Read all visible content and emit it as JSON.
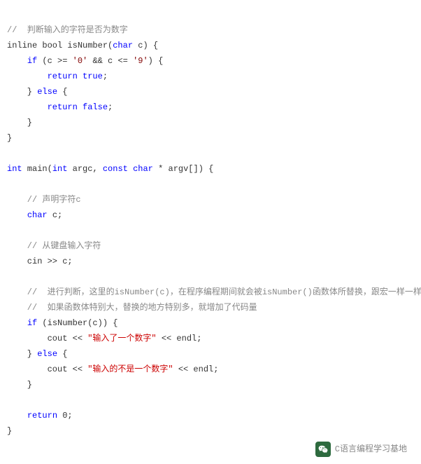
{
  "code": {
    "l01_c": "//  判断输入的字符是否为数字",
    "l02_a": "inline bool isNumber(",
    "l02_b": "char",
    "l02_c": " c) {",
    "l03_a": "    ",
    "l03_if": "if",
    "l03_b": " (c >= ",
    "l03_s1": "'0'",
    "l03_c": " && c <= ",
    "l03_s2": "'9'",
    "l03_d": ") {",
    "l04_a": "        ",
    "l04_ret": "return",
    "l04_b": " ",
    "l04_true": "true",
    "l04_c": ";",
    "l05_a": "    } ",
    "l05_else": "else",
    "l05_b": " {",
    "l06_a": "        ",
    "l06_ret": "return",
    "l06_b": " ",
    "l06_false": "false",
    "l06_c": ";",
    "l07": "    }",
    "l08": "}",
    "l10_a": "int",
    "l10_b": " main(",
    "l10_c": "int",
    "l10_d": " argc, ",
    "l10_e": "const",
    "l10_f": " ",
    "l10_g": "char",
    "l10_h": " * argv[]) {",
    "l12": "    // 声明字符c",
    "l13_a": "    ",
    "l13_b": "char",
    "l13_c": " c;",
    "l15": "    // 从键盘输入字符",
    "l16": "    cin >> c;",
    "l18": "    //  进行判断，这里的isNumber(c)，在程序编程期间就会被isNumber()函数体所替换，跟宏一样一样的",
    "l19": "    //  如果函数体特别大，替换的地方特别多，就增加了代码量",
    "l20_a": "    ",
    "l20_if": "if",
    "l20_b": " (isNumber(c)) {",
    "l21_a": "        cout << ",
    "l21_s": "\"输入了一个数字\"",
    "l21_b": " << endl;",
    "l22_a": "    } ",
    "l22_else": "else",
    "l22_b": " {",
    "l23_a": "        cout << ",
    "l23_s": "\"输入的不是一个数字\"",
    "l23_b": " << endl;",
    "l24": "    }",
    "l26_a": "    ",
    "l26_ret": "return",
    "l26_b": " 0;",
    "l27": "}"
  },
  "footer": {
    "label": "C语言编程学习基地"
  }
}
